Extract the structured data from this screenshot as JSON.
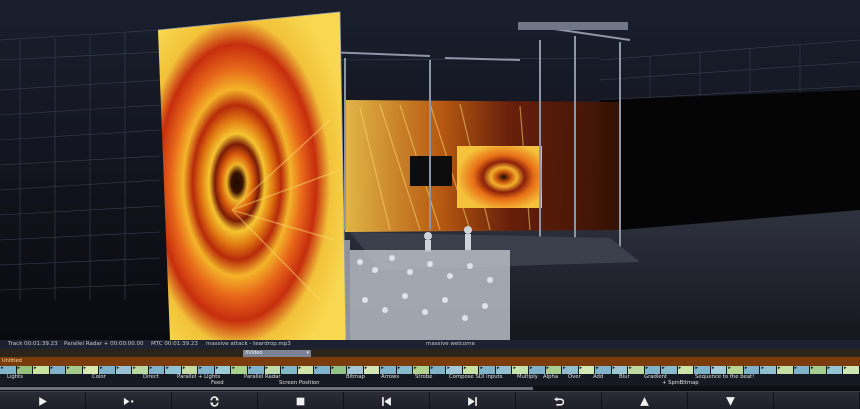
{
  "status": {
    "track": "Track 00:01:39.23",
    "layer": "Parallel Radar + 00:00:00.00",
    "mtc": "MTC 00:01:39.23",
    "file": "massive attack - teardrop.mp3",
    "cue_name": "massive welcome"
  },
  "tracks": {
    "video_layer": "XVideo",
    "untitled": "Untitled"
  },
  "cue_labels": [
    "Lights",
    "Color",
    "Direct",
    "Parallel + Lights",
    "Feed",
    "Parallel Radar",
    "Screen Position",
    "Bitmap",
    "Arrows",
    "Strobe",
    "Compose SDI inputs",
    "Multiply",
    "Alpha",
    "Over",
    "Add",
    "Blur",
    "Gradient",
    "+ SpinBitmap",
    "Sequence to the beat!"
  ],
  "cue_colors": [
    "#7fb3c9",
    "#93c07a",
    "#c9e39c",
    "#7fb3c9",
    "#a4c98a",
    "#d9e8b0",
    "#7fb3c9",
    "#96c2d4",
    "#b8d8a0",
    "#7fb3c9",
    "#8fc4d4",
    "#c2dca4",
    "#7fb3c9",
    "#9ccbd8",
    "#a8d18c",
    "#7fb3c9",
    "#bcdcb0",
    "#80b8c8",
    "#cfe4a8",
    "#7fb3c9",
    "#92c38a",
    "#a4c7d6",
    "#d1e6b4",
    "#7fb3c9",
    "#86b9cc",
    "#b0d490",
    "#7fb3c9",
    "#a0c8d6",
    "#c6e0a4",
    "#7fb3c9",
    "#92bfd0",
    "#c8e2ac",
    "#7fb3c9",
    "#a8ce92",
    "#8fbfce",
    "#d3e8b6",
    "#7fb3c9",
    "#9cc6d4",
    "#bcd9a0",
    "#7fb3c9",
    "#86bacb",
    "#cce3aa",
    "#7fb3c9",
    "#a2cbd8",
    "#b4d594",
    "#7fb3c9",
    "#90c0d0",
    "#c4deaa",
    "#7fb3c9",
    "#a6cd90",
    "#94c4d2",
    "#d0e6b2"
  ],
  "progress": 0.62,
  "transport": [
    {
      "name": "play-button",
      "icon": "play-icon"
    },
    {
      "name": "play-cue-button",
      "icon": "play-cue-icon"
    },
    {
      "name": "loop-button",
      "icon": "loop-icon"
    },
    {
      "name": "stop-button",
      "icon": "stop-icon"
    },
    {
      "name": "previous-button",
      "icon": "previous-icon"
    },
    {
      "name": "next-button",
      "icon": "next-icon"
    },
    {
      "name": "return-button",
      "icon": "return-icon"
    },
    {
      "name": "up-button",
      "icon": "up-icon"
    },
    {
      "name": "down-button",
      "icon": "down-icon"
    },
    {
      "name": "blank-button",
      "icon": ""
    }
  ]
}
